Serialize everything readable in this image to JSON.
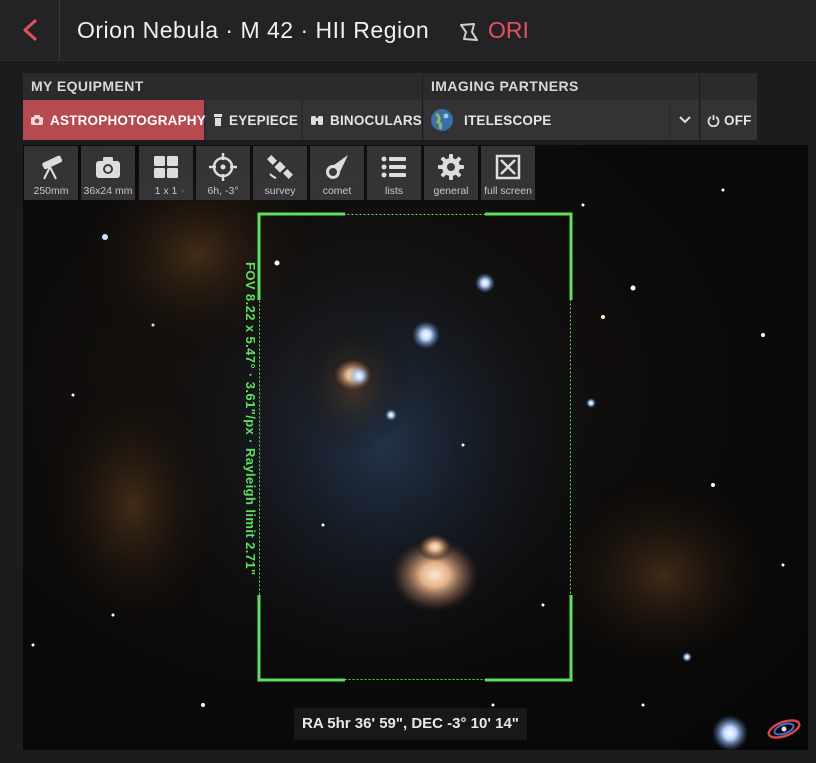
{
  "header": {
    "title": "Orion Nebula · M 42 · HII Region",
    "constellation": "ORI",
    "accent_color": "#e0525e"
  },
  "equipment": {
    "section_label": "MY EQUIPMENT",
    "buttons": [
      {
        "label": "ASTROPHOTOGRAPHY",
        "icon": "camera-icon",
        "active": true
      },
      {
        "label": "EYEPIECE",
        "icon": "eyepiece-icon",
        "active": false
      },
      {
        "label": "BINOCULARS",
        "icon": "binoculars-icon",
        "active": false
      }
    ]
  },
  "partners": {
    "section_label": "IMAGING PARTNERS",
    "selected": "ITELESCOPE",
    "toggle_label": "OFF"
  },
  "toolbar": [
    {
      "label": "250mm",
      "icon": "telescope-icon"
    },
    {
      "label": "36x24 mm",
      "icon": "camera-icon"
    },
    {
      "label": "1 x 1",
      "icon": "mosaic-grid-icon"
    },
    {
      "label": "6h, -3°",
      "icon": "crosshair-icon"
    },
    {
      "label": "survey",
      "icon": "satellite-icon"
    },
    {
      "label": "comet",
      "icon": "comet-icon"
    },
    {
      "label": "lists",
      "icon": "list-icon"
    },
    {
      "label": "general",
      "icon": "gear-icon"
    },
    {
      "label": "full screen",
      "icon": "fullscreen-icon"
    }
  ],
  "fov": {
    "label": "FOV 8.22 x 5.47° · 3.61\"/px · Rayleigh limit 2.71\"",
    "color": "#5ee05e"
  },
  "coordinates": "RA 5hr 36' 59\", DEC -3° 10' 14\""
}
